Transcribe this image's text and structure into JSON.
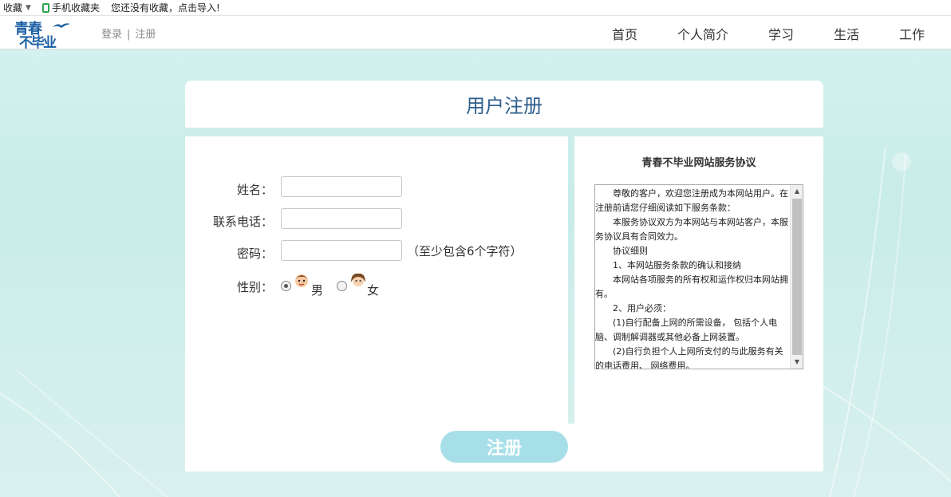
{
  "bookmark_bar": {
    "favorites_label": "收藏",
    "mobile_favorites_label": "手机收藏夹",
    "import_hint": "您还没有收藏，点击导入!"
  },
  "header": {
    "logo_line1": "青春",
    "logo_line2": "不毕业",
    "login_label": "登录",
    "divider": "|",
    "register_label": "注册",
    "nav": [
      "首页",
      "个人简介",
      "学习",
      "生活",
      "工作"
    ]
  },
  "page": {
    "title": "用户注册"
  },
  "form": {
    "name_label": "姓名：",
    "name_value": "",
    "phone_label": "联系电话：",
    "phone_value": "",
    "password_label": "密码：",
    "password_value": "",
    "password_note": "（至少包含6个字符）",
    "gender_label": "性别：",
    "gender_options": [
      "男",
      "女"
    ],
    "gender_selected": "男",
    "submit_label": "注册"
  },
  "agreement": {
    "title": "青春不毕业网站服务协议",
    "paragraphs": [
      "尊敬的客户，欢迎您注册成为本网站用户。在注册前请您仔细阅读如下服务条款：",
      "本服务协议双方为本网站与本网站客户，本服务协议具有合同效力。",
      "协议细则",
      "1、本网站服务条款的确认和接纳",
      "本网站各项服务的所有权和运作权归本网站拥有。",
      "2、用户必须：",
      "(1)自行配备上网的所需设备， 包括个人电脑、调制解调器或其他必备上网装置。",
      "(2)自行负担个人上网所支付的与此服务有关的电话费用、 网络费用。"
    ]
  },
  "colors": {
    "brand_blue": "#1b5fa3",
    "title_blue": "#2d5e8e",
    "button_teal": "#a7dfe8",
    "background": "#d7f3f0"
  }
}
